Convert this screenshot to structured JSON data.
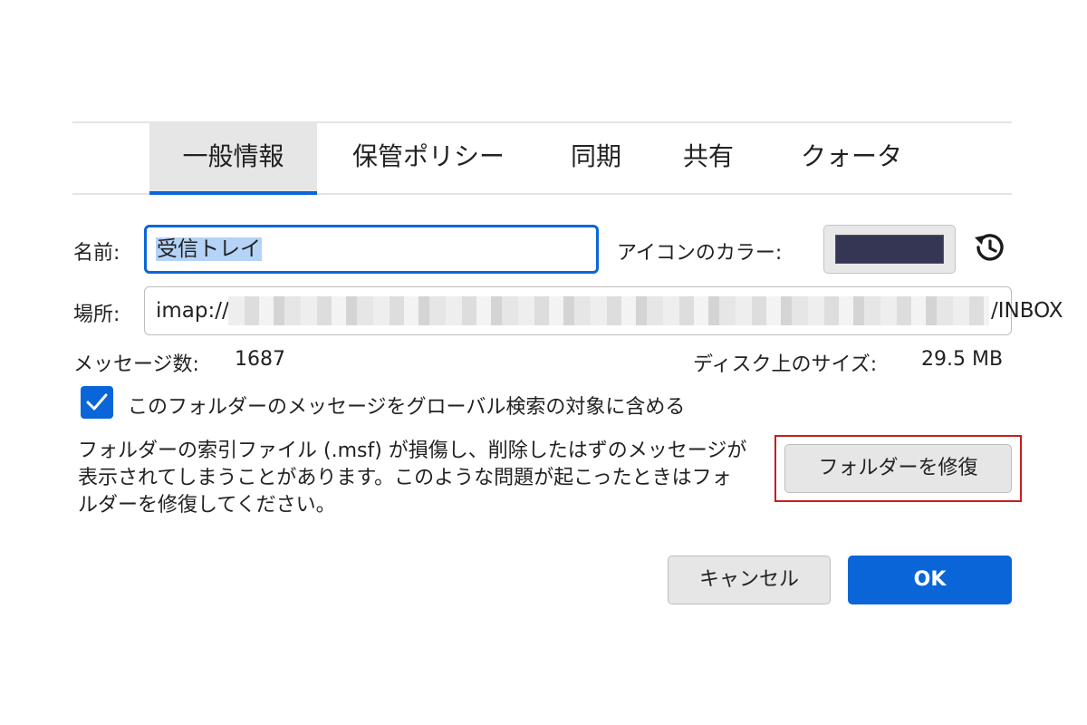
{
  "tabs": [
    {
      "label": "一般情報",
      "active": true
    },
    {
      "label": "保管ポリシー",
      "active": false
    },
    {
      "label": "同期",
      "active": false
    },
    {
      "label": "共有",
      "active": false
    },
    {
      "label": "クォータ",
      "active": false
    }
  ],
  "general": {
    "name_label": "名前:",
    "name_value": "受信トレイ",
    "icon_color_label": "アイコンのカラー:",
    "icon_color": "#343654",
    "reset_icon": "history-reset-icon",
    "location_label": "場所:",
    "location_prefix": "imap://",
    "location_suffix": "/INBOX",
    "message_count_label": "メッセージ数:",
    "message_count_value": "1687",
    "disk_size_label": "ディスク上のサイズ:",
    "disk_size_value": "29.5 MB",
    "global_search_checkbox": {
      "checked": true,
      "label": "このフォルダーのメッセージをグローバル検索の対象に含める"
    },
    "repair_description": "フォルダーの索引ファイル (.msf) が損傷し、削除したはずのメッセージが表示されてしまうことがあります。このような問題が起こったときはフォルダーを修復してください。",
    "repair_button_label": "フォルダーを修復"
  },
  "footer": {
    "cancel_label": "キャンセル",
    "ok_label": "OK"
  },
  "colors": {
    "accent": "#0a66d8",
    "highlight_frame": "#c91d1d"
  }
}
